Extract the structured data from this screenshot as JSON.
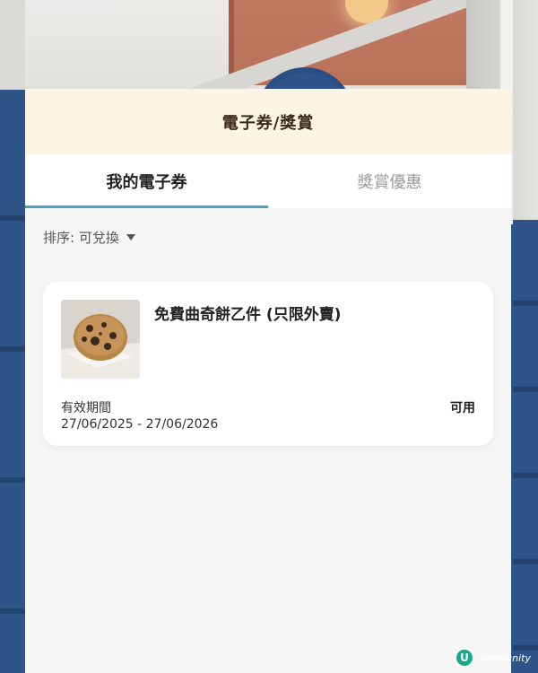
{
  "header": {
    "title": "電子券/獎賞"
  },
  "tabs": [
    {
      "label": "我的電子券",
      "active": true
    },
    {
      "label": "獎賞優惠",
      "active": false
    }
  ],
  "sort": {
    "label": "排序: 可兌換",
    "icon": "caret-down-icon"
  },
  "coupons": [
    {
      "title": "免費曲奇餅乙件 (只限外賣)",
      "validity_label": "有效期間",
      "validity_dates": "27/06/2025 - 27/06/2026",
      "status": "可用",
      "image": "cookie-thumbnail"
    }
  ],
  "watermark": {
    "logo": "U",
    "text": "community"
  },
  "colors": {
    "header_bg": "#fdf5e4",
    "tab_underline": "#4aa3c4",
    "panel_bg": "#f6f6f6"
  }
}
